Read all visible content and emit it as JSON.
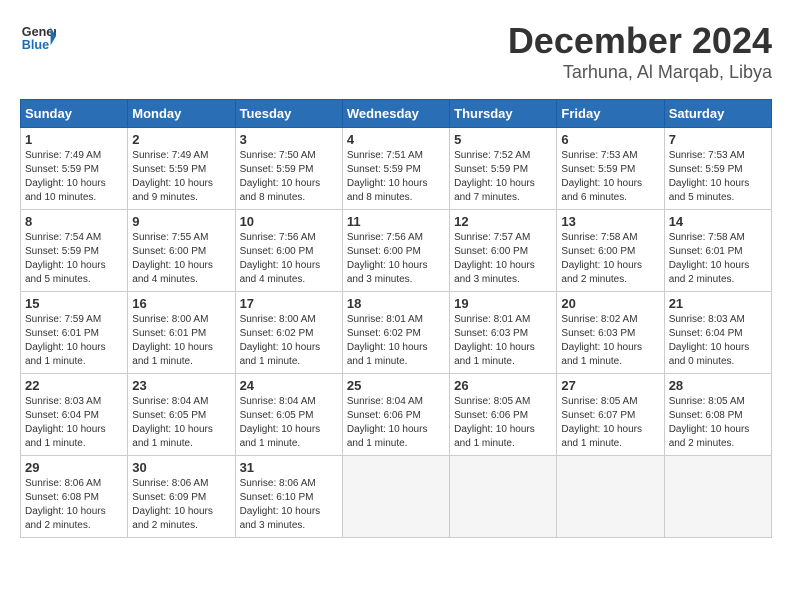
{
  "header": {
    "logo_line1": "General",
    "logo_line2": "Blue",
    "month": "December 2024",
    "location": "Tarhuna, Al Marqab, Libya"
  },
  "days_of_week": [
    "Sunday",
    "Monday",
    "Tuesday",
    "Wednesday",
    "Thursday",
    "Friday",
    "Saturday"
  ],
  "weeks": [
    [
      {
        "day": "1",
        "text": "Sunrise: 7:49 AM\nSunset: 5:59 PM\nDaylight: 10 hours\nand 10 minutes."
      },
      {
        "day": "2",
        "text": "Sunrise: 7:49 AM\nSunset: 5:59 PM\nDaylight: 10 hours\nand 9 minutes."
      },
      {
        "day": "3",
        "text": "Sunrise: 7:50 AM\nSunset: 5:59 PM\nDaylight: 10 hours\nand 8 minutes."
      },
      {
        "day": "4",
        "text": "Sunrise: 7:51 AM\nSunset: 5:59 PM\nDaylight: 10 hours\nand 8 minutes."
      },
      {
        "day": "5",
        "text": "Sunrise: 7:52 AM\nSunset: 5:59 PM\nDaylight: 10 hours\nand 7 minutes."
      },
      {
        "day": "6",
        "text": "Sunrise: 7:53 AM\nSunset: 5:59 PM\nDaylight: 10 hours\nand 6 minutes."
      },
      {
        "day": "7",
        "text": "Sunrise: 7:53 AM\nSunset: 5:59 PM\nDaylight: 10 hours\nand 5 minutes."
      }
    ],
    [
      {
        "day": "8",
        "text": "Sunrise: 7:54 AM\nSunset: 5:59 PM\nDaylight: 10 hours\nand 5 minutes."
      },
      {
        "day": "9",
        "text": "Sunrise: 7:55 AM\nSunset: 6:00 PM\nDaylight: 10 hours\nand 4 minutes."
      },
      {
        "day": "10",
        "text": "Sunrise: 7:56 AM\nSunset: 6:00 PM\nDaylight: 10 hours\nand 4 minutes."
      },
      {
        "day": "11",
        "text": "Sunrise: 7:56 AM\nSunset: 6:00 PM\nDaylight: 10 hours\nand 3 minutes."
      },
      {
        "day": "12",
        "text": "Sunrise: 7:57 AM\nSunset: 6:00 PM\nDaylight: 10 hours\nand 3 minutes."
      },
      {
        "day": "13",
        "text": "Sunrise: 7:58 AM\nSunset: 6:00 PM\nDaylight: 10 hours\nand 2 minutes."
      },
      {
        "day": "14",
        "text": "Sunrise: 7:58 AM\nSunset: 6:01 PM\nDaylight: 10 hours\nand 2 minutes."
      }
    ],
    [
      {
        "day": "15",
        "text": "Sunrise: 7:59 AM\nSunset: 6:01 PM\nDaylight: 10 hours\nand 1 minute."
      },
      {
        "day": "16",
        "text": "Sunrise: 8:00 AM\nSunset: 6:01 PM\nDaylight: 10 hours\nand 1 minute."
      },
      {
        "day": "17",
        "text": "Sunrise: 8:00 AM\nSunset: 6:02 PM\nDaylight: 10 hours\nand 1 minute."
      },
      {
        "day": "18",
        "text": "Sunrise: 8:01 AM\nSunset: 6:02 PM\nDaylight: 10 hours\nand 1 minute."
      },
      {
        "day": "19",
        "text": "Sunrise: 8:01 AM\nSunset: 6:03 PM\nDaylight: 10 hours\nand 1 minute."
      },
      {
        "day": "20",
        "text": "Sunrise: 8:02 AM\nSunset: 6:03 PM\nDaylight: 10 hours\nand 1 minute."
      },
      {
        "day": "21",
        "text": "Sunrise: 8:03 AM\nSunset: 6:04 PM\nDaylight: 10 hours\nand 0 minutes."
      }
    ],
    [
      {
        "day": "22",
        "text": "Sunrise: 8:03 AM\nSunset: 6:04 PM\nDaylight: 10 hours\nand 1 minute."
      },
      {
        "day": "23",
        "text": "Sunrise: 8:04 AM\nSunset: 6:05 PM\nDaylight: 10 hours\nand 1 minute."
      },
      {
        "day": "24",
        "text": "Sunrise: 8:04 AM\nSunset: 6:05 PM\nDaylight: 10 hours\nand 1 minute."
      },
      {
        "day": "25",
        "text": "Sunrise: 8:04 AM\nSunset: 6:06 PM\nDaylight: 10 hours\nand 1 minute."
      },
      {
        "day": "26",
        "text": "Sunrise: 8:05 AM\nSunset: 6:06 PM\nDaylight: 10 hours\nand 1 minute."
      },
      {
        "day": "27",
        "text": "Sunrise: 8:05 AM\nSunset: 6:07 PM\nDaylight: 10 hours\nand 1 minute."
      },
      {
        "day": "28",
        "text": "Sunrise: 8:05 AM\nSunset: 6:08 PM\nDaylight: 10 hours\nand 2 minutes."
      }
    ],
    [
      {
        "day": "29",
        "text": "Sunrise: 8:06 AM\nSunset: 6:08 PM\nDaylight: 10 hours\nand 2 minutes."
      },
      {
        "day": "30",
        "text": "Sunrise: 8:06 AM\nSunset: 6:09 PM\nDaylight: 10 hours\nand 2 minutes."
      },
      {
        "day": "31",
        "text": "Sunrise: 8:06 AM\nSunset: 6:10 PM\nDaylight: 10 hours\nand 3 minutes."
      },
      {
        "day": "",
        "text": ""
      },
      {
        "day": "",
        "text": ""
      },
      {
        "day": "",
        "text": ""
      },
      {
        "day": "",
        "text": ""
      }
    ]
  ]
}
